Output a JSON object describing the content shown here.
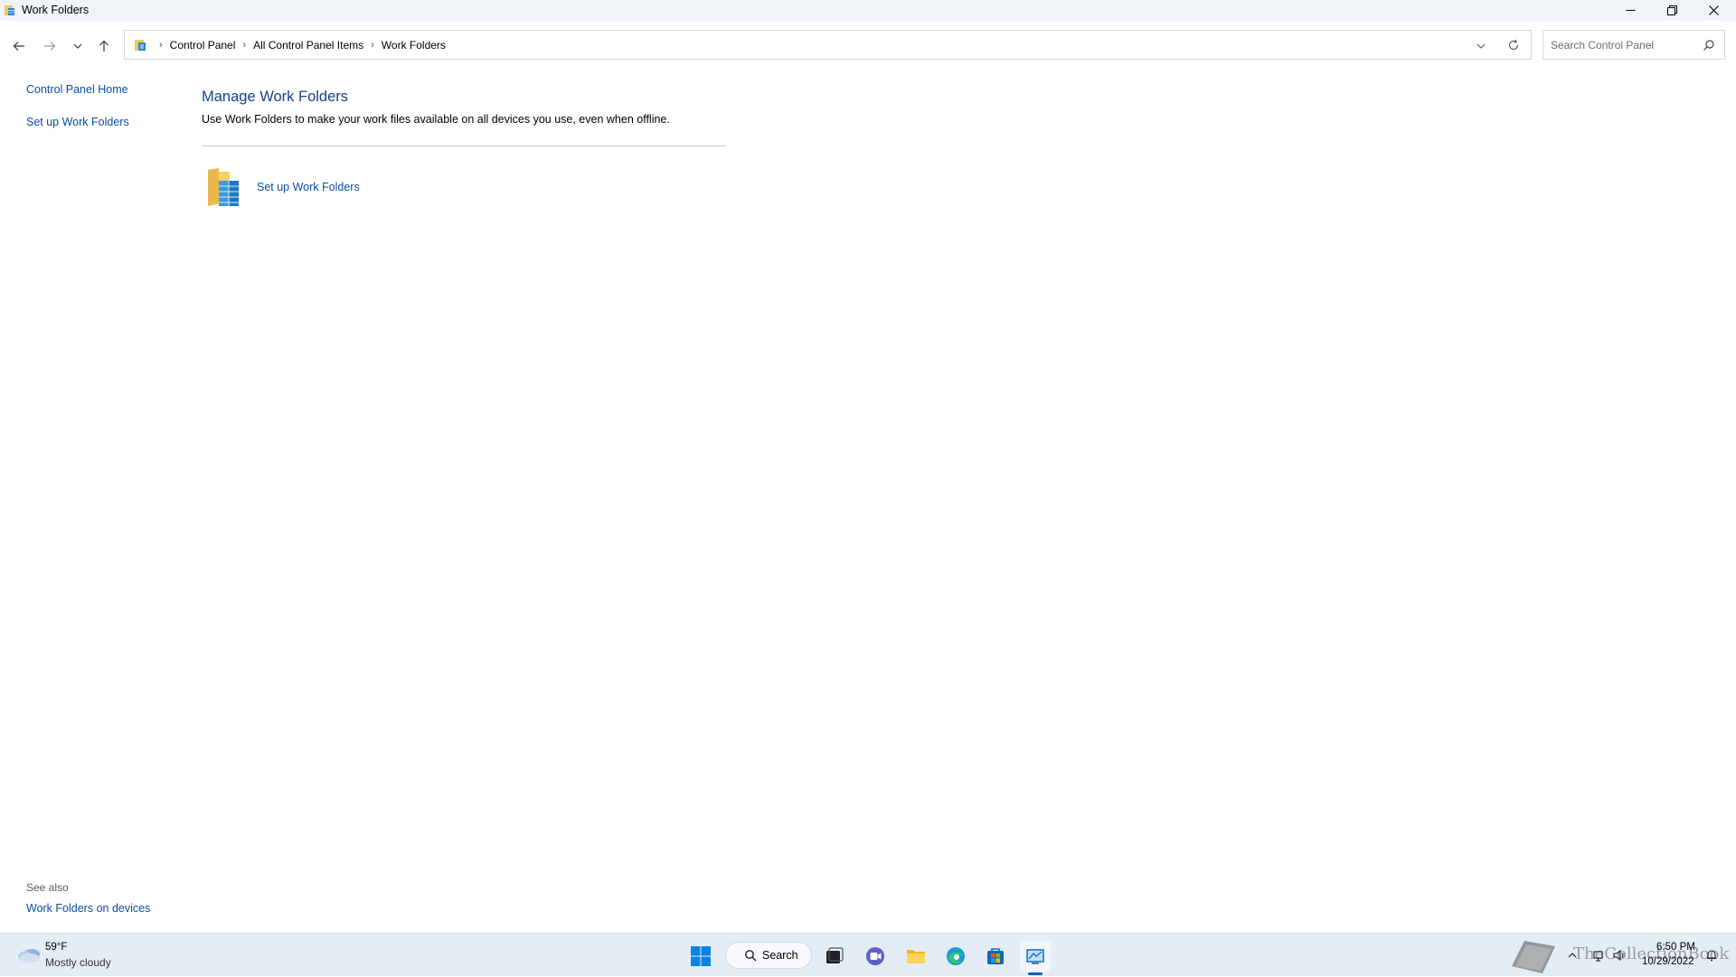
{
  "window": {
    "title": "Work Folders",
    "controls": {
      "minimize": "minimize-icon",
      "restore": "restore-icon",
      "close": "close-icon"
    }
  },
  "address_bar": {
    "breadcrumbs": [
      "Control Panel",
      "All Control Panel Items",
      "Work Folders"
    ]
  },
  "search": {
    "placeholder": "Search Control Panel"
  },
  "left_pane": {
    "links": [
      "Control Panel Home",
      "Set up Work Folders"
    ],
    "see_also_label": "See also",
    "see_also_links": [
      "Work Folders on devices"
    ]
  },
  "main": {
    "title": "Manage Work Folders",
    "description": "Use Work Folders to make your work files available on all devices you use, even when offline.",
    "task_link": "Set up Work Folders"
  },
  "taskbar": {
    "weather_temp": "59°F",
    "weather_desc": "Mostly cloudy",
    "search_label": "Search",
    "clock_time": "6:50 PM",
    "clock_date": "10/29/2022",
    "watermark_text": "TheCollectionBook"
  },
  "colors": {
    "link": "#0b4ea2",
    "heading": "#163f8e",
    "taskbar": "#e4ecf6",
    "accent": "#0067c0"
  }
}
